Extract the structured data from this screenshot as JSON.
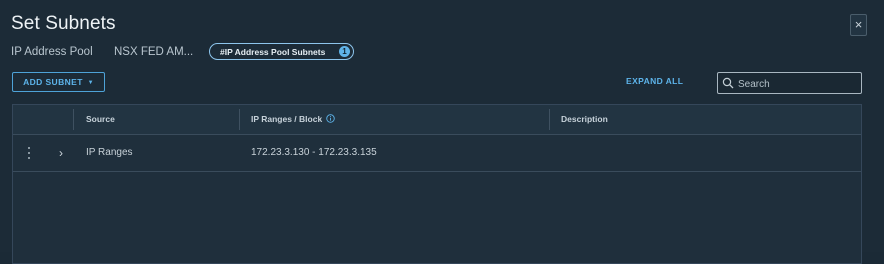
{
  "dialog": {
    "title": "Set Subnets",
    "close_glyph": "×"
  },
  "pool": {
    "label": "IP Address Pool",
    "value": "NSX FED AM...",
    "pill_label": "#IP Address Pool Subnets",
    "pill_badge": "1"
  },
  "toolbar": {
    "add_subnet_label": "ADD SUBNET",
    "expand_all_label": "EXPAND ALL",
    "search_placeholder": "Search"
  },
  "grid": {
    "columns": [
      "Source",
      "IP Ranges / Block",
      "Description"
    ],
    "rows": [
      {
        "source": "IP Ranges",
        "ip_ranges": "172.23.3.130 - 172.23.3.135",
        "description": ""
      }
    ]
  },
  "colors": {
    "background": "#1c2b37",
    "accent": "#5db4ea",
    "border": "#35475a"
  },
  "icons": [
    "close-icon",
    "info-icon",
    "search-icon",
    "chevron-down-icon",
    "chevron-right-icon",
    "kebab-icon"
  ]
}
